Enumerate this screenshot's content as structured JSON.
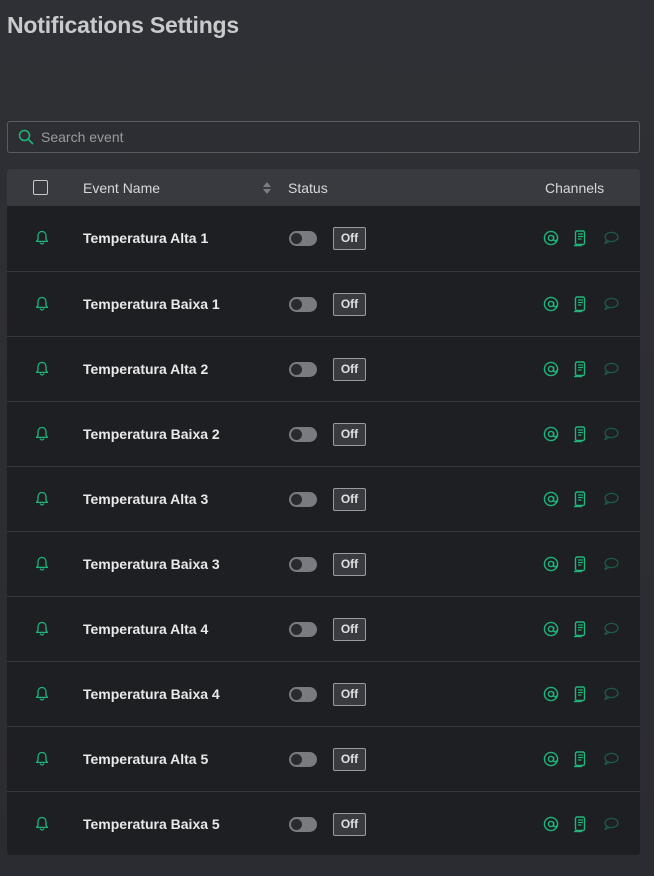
{
  "page": {
    "title": "Notifications Settings"
  },
  "search": {
    "placeholder": "Search event",
    "value": ""
  },
  "table": {
    "columns": {
      "event_name": "Event Name",
      "status": "Status",
      "channels": "Channels"
    },
    "rows": [
      {
        "name": "Temperatura Alta 1",
        "status_label": "Off",
        "enabled": false
      },
      {
        "name": "Temperatura Baixa 1",
        "status_label": "Off",
        "enabled": false
      },
      {
        "name": "Temperatura Alta 2",
        "status_label": "Off",
        "enabled": false
      },
      {
        "name": "Temperatura Baixa 2",
        "status_label": "Off",
        "enabled": false
      },
      {
        "name": "Temperatura Alta 3",
        "status_label": "Off",
        "enabled": false
      },
      {
        "name": "Temperatura Baixa 3",
        "status_label": "Off",
        "enabled": false
      },
      {
        "name": "Temperatura Alta 4",
        "status_label": "Off",
        "enabled": false
      },
      {
        "name": "Temperatura Baixa 4",
        "status_label": "Off",
        "enabled": false
      },
      {
        "name": "Temperatura Alta 5",
        "status_label": "Off",
        "enabled": false
      },
      {
        "name": "Temperatura Baixa 5",
        "status_label": "Off",
        "enabled": false
      }
    ]
  },
  "icons": {
    "search": "search-icon",
    "row": "bell-icon",
    "channels": [
      "email-at-icon",
      "sms-phone-icon",
      "chat-bubble-icon"
    ],
    "sort": "sort-icon"
  },
  "colors": {
    "accent": "#1fb57a",
    "accent_dim": "#1d5a45",
    "background": "#2f3035",
    "table_bg": "#1e1f23",
    "header_bg": "#393a3f"
  }
}
